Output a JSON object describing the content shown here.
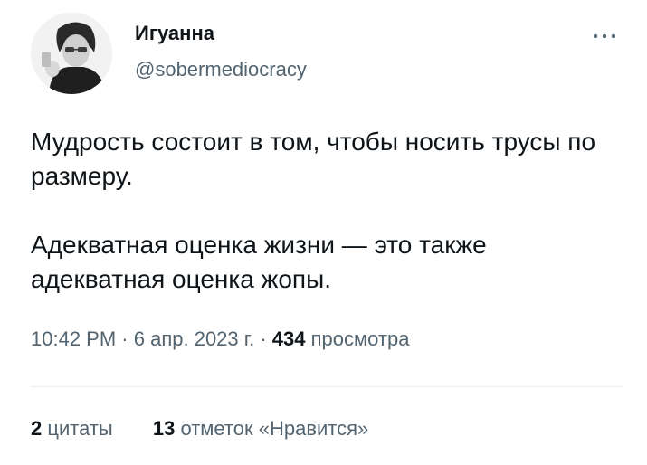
{
  "author": {
    "display_name": "Игуанна",
    "handle": "@sobermediocracy"
  },
  "tweet": {
    "paragraphs": [
      "Мудрость состоит в том, чтобы носить трусы по размеру.",
      "Адекватная оценка жизни — это также адекватная оценка жопы."
    ],
    "time": "10:42 PM",
    "separator": "·",
    "date": "6 апр. 2023 г.",
    "views_count": "434",
    "views_label": "просмотра"
  },
  "stats": {
    "quotes_count": "2",
    "quotes_label": "цитаты",
    "likes_count": "13",
    "likes_label": "отметок «Нравится»"
  },
  "icons": {
    "more": "more-horizontal-icon"
  }
}
